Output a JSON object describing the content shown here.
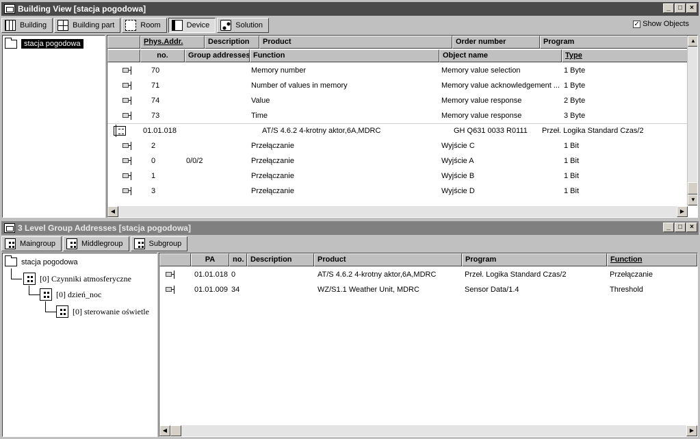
{
  "building_view": {
    "title": "Building View [stacja pogodowa]",
    "window_buttons": [
      "_",
      "□",
      "×"
    ],
    "toolbar": [
      {
        "label": "Building",
        "icon": "building-icon"
      },
      {
        "label": "Building part",
        "icon": "building-part-icon"
      },
      {
        "label": "Room",
        "icon": "room-icon"
      },
      {
        "label": "Device",
        "icon": "device-icon"
      },
      {
        "label": "Solution",
        "icon": "solution-icon"
      }
    ],
    "show_objects_label": "Show Objects",
    "show_objects_checked": true,
    "tree": {
      "root": "stacja pogodowa"
    },
    "header_top": [
      "Phys.Addr.",
      "Description",
      "Product",
      "Order number",
      "Program"
    ],
    "header_sub": [
      "no.",
      "Group addresses",
      "Function",
      "Object name",
      "Type"
    ],
    "rows": [
      {
        "kind": "obj",
        "no": "70",
        "group": "",
        "function": "Memory number",
        "object": "Memory value selection",
        "type": "1 Byte"
      },
      {
        "kind": "obj",
        "no": "71",
        "group": "",
        "function": "Number of values in memory",
        "object": "Memory value acknowledgement ...",
        "type": "1 Byte"
      },
      {
        "kind": "obj",
        "no": "74",
        "group": "",
        "function": "Value",
        "object": "Memory value response",
        "type": "2 Byte"
      },
      {
        "kind": "obj",
        "no": "73",
        "group": "",
        "function": "Time",
        "object": "Memory value response",
        "type": "3 Byte"
      },
      {
        "kind": "device",
        "addr": "01.01.018",
        "product": "AT/S 4.6.2 4-krotny aktor,6A,MDRC",
        "order": "GH Q631 0033 R0111",
        "program": "Przeł. Logika Standard Czas/2"
      },
      {
        "kind": "obj",
        "no": "2",
        "group": "",
        "function": "Przełączanie",
        "object": "Wyjście C",
        "type": "1 Bit"
      },
      {
        "kind": "obj",
        "no": "0",
        "group": "0/0/2",
        "function": "Przełączanie",
        "object": "Wyjście A",
        "type": "1 Bit"
      },
      {
        "kind": "obj",
        "no": "1",
        "group": "",
        "function": "Przełączanie",
        "object": "Wyjście B",
        "type": "1 Bit"
      },
      {
        "kind": "obj",
        "no": "3",
        "group": "",
        "function": "Przełączanie",
        "object": "Wyjście D",
        "type": "1 Bit"
      }
    ]
  },
  "group_view": {
    "title": "3 Level Group Addresses [stacja pogodowa]",
    "toolbar": [
      {
        "label": "Maingroup"
      },
      {
        "label": "Middlegroup"
      },
      {
        "label": "Subgroup"
      }
    ],
    "tree": {
      "root": "stacja pogodowa",
      "main": "[0] Czynniki atmosferyczne",
      "middle": "[0] dzień_noc",
      "sub": "[0] sterowanie oświetle"
    },
    "header": [
      "PA",
      "no.",
      "Description",
      "Product",
      "Program",
      "Function"
    ],
    "rows": [
      {
        "pa": "01.01.018",
        "no": "0",
        "description": "",
        "product": "AT/S 4.6.2 4-krotny aktor,6A,MDRC",
        "program": "Przeł. Logika Standard Czas/2",
        "function": "Przełączanie"
      },
      {
        "pa": "01.01.009",
        "no": "34",
        "description": "",
        "product": "WZ/S1.1 Weather Unit, MDRC",
        "program": "Sensor Data/1.4",
        "function": "Threshold"
      }
    ]
  }
}
